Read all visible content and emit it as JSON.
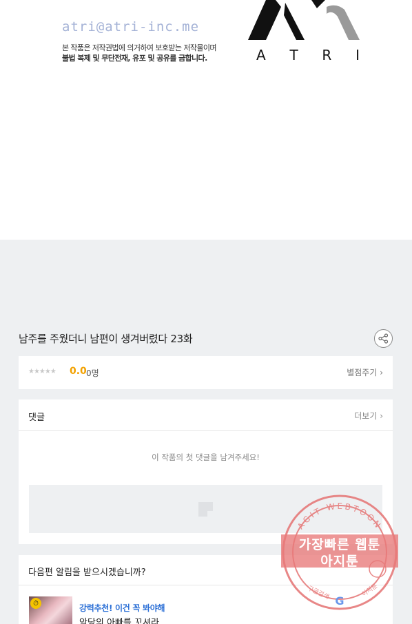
{
  "artwork": {
    "email": "atri@atri-inc.me",
    "copyright_line1": "본 작품은 저작권법에 의거하여 보호받는 저작물이며",
    "copyright_line2": "불법 복제 및 무단전재, 유포 및 공유를 금합니다.",
    "logo_letters": [
      "A",
      "T",
      "R",
      "I"
    ]
  },
  "episode": {
    "title": "남주를 주웠더니 남편이 생겨버렸다 23화",
    "share_icon": "share-icon"
  },
  "rating": {
    "stars": "★★★★★",
    "score": "0.0",
    "count": "0명",
    "rate_link": "별점주기 ›"
  },
  "comments": {
    "title": "댓글",
    "more_link": "더보기 ›",
    "empty_text": "이 작품의 첫 댓글을 남겨주세요!"
  },
  "notify": {
    "title": "다음편 알림을 받으시겠습니까?",
    "recommend_tag": "강력추천! 이건 꼭 봐야해",
    "recommend_name": "악당의 아빠를 꼬셔라"
  },
  "watermark": {
    "arc_text": "AGIT WEBTOON",
    "line1": "가장빠른 웹툰",
    "line2": "아지툰",
    "bottom_left": "구글검색",
    "bottom_right": "아지툰",
    "bottom_mark": "G"
  },
  "colors": {
    "accent_score": "#f2a100",
    "recommend_blue": "#2b6fd6",
    "stamp_red": "#e57373"
  }
}
